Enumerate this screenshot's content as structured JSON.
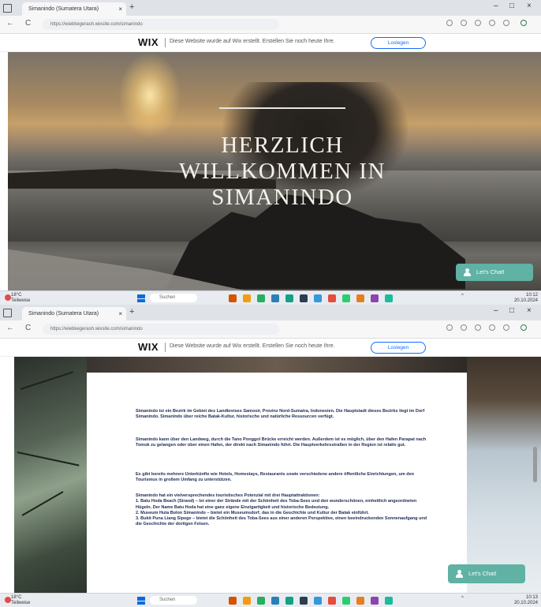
{
  "browser": {
    "tab_title": "Simanindo (Sumatera Utara)",
    "tab_close": "×",
    "new_tab": "+",
    "url": "https://wiebkegerash.wixsite.com/simanindo",
    "nav_back": "←",
    "nav_reload": "C",
    "win_min": "–",
    "win_max": "□",
    "win_close": "×"
  },
  "wix_banner": {
    "logo": "WIX",
    "text": "Diese Website wurde auf Wix erstellt. Erstellen Sie noch heute Ihre.",
    "button": "Loslegen"
  },
  "hero": {
    "subtitle": "Willkommen in Simanindo",
    "title": "HERZLICH WILLKOMMEN IN SIMANINDO"
  },
  "chat": {
    "label": "Let's Chat!"
  },
  "taskbar": {
    "weather_temp": "18°C",
    "weather_desc": "Teilweise",
    "search_placeholder": "Suchen",
    "time_top": "10:12",
    "date_top": "20.10.2024",
    "time_bottom": "10:13",
    "date_bottom": "20.10.2024",
    "icon_colors": [
      "#d35400",
      "#f39c12",
      "#27ae60",
      "#2980b9",
      "#16a085",
      "#2c3e50",
      "#3498db",
      "#e74c3c",
      "#2ecc71",
      "#e67e22",
      "#8e44ad",
      "#1abc9c"
    ]
  },
  "content": {
    "paragraphs": [
      "Simanindo ist ein Bezirk im Gebiet des Landkreises Samosir, Provinz Nord-Sumatra, Indonesien. Die Hauptstadt dieses Bezirks liegt im Dorf Simanindo. Simanindo über reiche Batak-Kultur, historische und natürliche Ressourcen verfügt.",
      "Simanindo kann über den Landweg, durch die Tano Ponggol Brücke erreicht werden. Außerdem ist es möglich, über den Hafen Parapat nach Tomok zu gelangen oder über einen Hafen, der direkt nach Simanindo führt. Die Hauptverkehrsstraßen in der Region ist relativ gut.",
      "Es gibt bereits mehrere Unterkünfte wie Hotels, Homestays, Restaurants sowie verschiedene andere öffentliche Einrichtungen, um den Tourismus in großem Umfang zu unterstützen.",
      "Simanindo hat ein vielversprechendes touristisches Potenzial mit drei Hauptattraktionen:\n1. Batu Hoda Beach (Strand) – Ist einer der Strände mit der Schönheit des Toba-Sees und den wunderschönen, einheitlich angeordneten Hügeln. Der Name Batu Hoda hat eine ganz eigene Einzigartigkeit und historische Bedeutung.\n2. Museum Huta Bolon Simanindo – bietet ein Museumsdorf, das in die Geschichte und Kultur der Batak einführt.\n3. Bukit Puna Liang Sipege – bietet die Schönheit des Toba-Sees aus einer anderen Perspektive, einen beeindruckenden Sonnenaufgang und die Geschichte der dortigen Felsen."
    ]
  }
}
